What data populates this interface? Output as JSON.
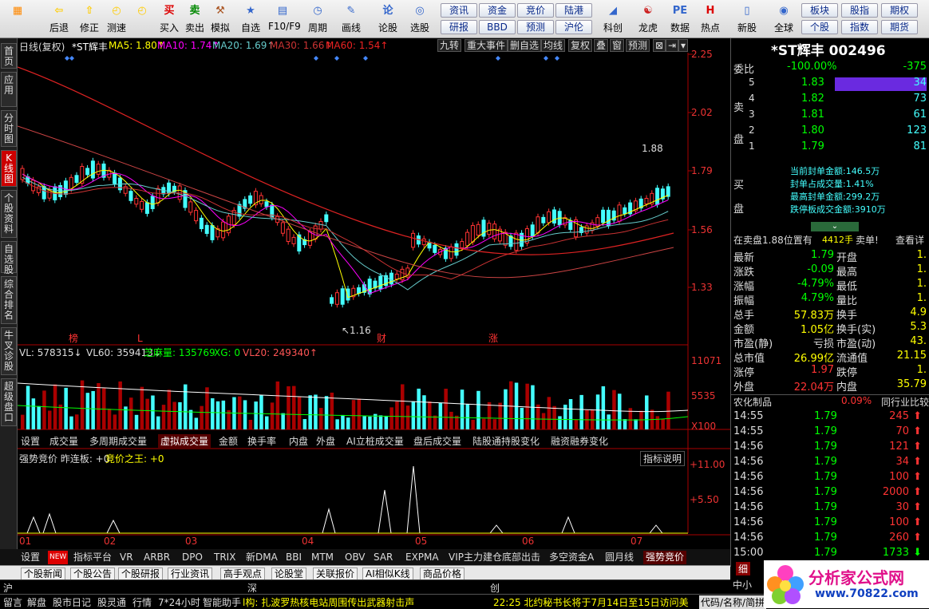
{
  "toolbar": {
    "buttons": [
      {
        "label": "",
        "icon": "grid-icon"
      },
      {
        "label": "后退",
        "icon": "arrow-left-icon"
      },
      {
        "label": "修正",
        "icon": "arrow-up-icon"
      },
      {
        "label": "测速",
        "icon": "clock-icon"
      },
      {
        "label": "",
        "icon": "clock-icon"
      },
      {
        "label": "买入",
        "icon": "buy-icon"
      },
      {
        "label": "卖出",
        "icon": "sell-icon"
      },
      {
        "label": "模拟",
        "icon": "hammer-icon"
      },
      {
        "label": "自选",
        "icon": "star-icon"
      },
      {
        "label": "F10/F9",
        "icon": "f10-icon"
      },
      {
        "label": "周期",
        "icon": "period-icon"
      },
      {
        "label": "画线",
        "icon": "pencil-icon"
      },
      {
        "label": "论股",
        "icon": "discuss-icon"
      },
      {
        "label": "选股",
        "icon": "pick-icon"
      },
      {
        "label": "科创",
        "icon": "kc-icon"
      },
      {
        "label": "龙虎",
        "icon": "dragon-icon"
      },
      {
        "label": "数据",
        "icon": "pe-icon"
      },
      {
        "label": "热点",
        "icon": "hot-icon"
      },
      {
        "label": "新股",
        "icon": "new-icon"
      },
      {
        "label": "全球",
        "icon": "globe-icon"
      }
    ],
    "grid_left": [
      "资讯",
      "资金",
      "竞价",
      "陆港",
      "研报",
      "BBD",
      "预测",
      "沪伦"
    ],
    "grid_right": [
      "板块",
      "股指",
      "期权",
      "个股",
      "指数",
      "期货"
    ]
  },
  "sidebar": [
    "首页",
    "应用",
    "分时图",
    "K线图",
    "个股资料",
    "自选股",
    "综合排名",
    "牛叉诊股",
    "超级盘口"
  ],
  "chart": {
    "header_left": "日线(复权)",
    "stock_name": "*ST辉丰",
    "ma5_label": "MA5: 1.80↑",
    "ma10_label": "MA10: 1.74↑",
    "ma20_label": "MA20: 1.69↑",
    "ma30_label": "MA30: 1.66↑",
    "ma60_label": "MA60: 1.54↑",
    "menu_tabs": [
      "九转",
      "重大事件",
      "删自选",
      "均线",
      "复权",
      "叠",
      "窗",
      "预测"
    ],
    "price_ticks": [
      "2.25",
      "2.02",
      "1.79",
      "1.56",
      "1.33"
    ],
    "high_label": "1.88",
    "low_label": "1.16",
    "markers": [
      "榜",
      "L",
      "财",
      "涨"
    ],
    "vol_header": {
      "vl": "VL: 578315",
      "vl60": "VL60: 359413",
      "zm": "芝麻量: 135769",
      "xg": "XG: 0",
      "vl20": "VL20: 249340"
    },
    "vol_ticks": [
      "11071",
      "5535",
      "X100"
    ],
    "vol_tabs": [
      "设置",
      "成交量",
      "多周期成交量",
      "虚拟成交量",
      "金额",
      "换手率",
      "内盘",
      "外盘",
      "AI立桩成交量",
      "盘后成交量",
      "陆股通持股变化",
      "融资融券变化"
    ],
    "ind_header": "强势竞价 昨连板: +0",
    "ind_header2": "竞价之王: +0",
    "ind_button": "指标说明",
    "ind_ticks": [
      "+11.00",
      "+5.50"
    ],
    "months": [
      "01",
      "02",
      "03",
      "04",
      "05",
      "06",
      "07"
    ]
  },
  "bottom_tabs": [
    "设置",
    "NEW",
    "指标平台",
    "VR",
    "ARBR",
    "DPO",
    "TRIX",
    "新DMA",
    "BBI",
    "MTM",
    "OBV",
    "SAR",
    "EXPMA",
    "VIP主力建仓底部出击",
    "多空资金A",
    "圆月线",
    "强势竞价"
  ],
  "news_tabs": [
    "个股新闻",
    "个股公告",
    "个股研报",
    "行业资讯",
    "高手观点",
    "论股堂",
    "关联报价",
    "AI相似K线",
    "商品价格"
  ],
  "market": {
    "sh": "沪",
    "sz": "深",
    "cy": "创"
  },
  "status": {
    "items": [
      "留言",
      "解盘",
      "股市日记",
      "股灵通",
      "行情",
      "7*24小时",
      "智能助手"
    ],
    "ticker": "l构: 扎波罗热核电站周围传出武器射击声",
    "ticker2": "22:25 北约秘书长将于7月14日至15日访问美",
    "code": "代码/名称/简拼"
  },
  "quote": {
    "title": "*ST辉丰 002496",
    "wb_label": "委比",
    "wb": "-100.00%",
    "wc": "-375",
    "sell_label": "卖盘",
    "buy_label": "买盘",
    "sells": [
      {
        "n": "5",
        "p": "1.83",
        "v": "34"
      },
      {
        "n": "4",
        "p": "1.82",
        "v": "73"
      },
      {
        "n": "3",
        "p": "1.81",
        "v": "61"
      },
      {
        "n": "2",
        "p": "1.80",
        "v": "123"
      },
      {
        "n": "1",
        "p": "1.79",
        "v": "81"
      }
    ],
    "fengdan": [
      "当前封单金额:146.5万",
      "封单占成交量:1.41%",
      "最高封单金额:299.2万",
      "跌停板成交金额:3910万"
    ],
    "zaimai": "在卖盘1.88位置有",
    "zaimai_v": "4412手",
    "zaimai_t": "卖单!",
    "zaimai_b": "查看详",
    "stats": [
      {
        "k1": "最新",
        "v1": "1.79",
        "k2": "开盘",
        "v2": "1."
      },
      {
        "k1": "涨跌",
        "v1": "-0.09",
        "k2": "最高",
        "v2": "1."
      },
      {
        "k1": "涨幅",
        "v1": "-4.79%",
        "k2": "最低",
        "v2": "1."
      },
      {
        "k1": "振幅",
        "v1": "4.79%",
        "k2": "量比",
        "v2": "1."
      },
      {
        "k1": "总手",
        "v1": "57.83万",
        "k2": "换手",
        "v2": "4.9"
      },
      {
        "k1": "金额",
        "v1": "1.05亿",
        "k2": "换手(实)",
        "v2": "5.3"
      },
      {
        "k1": "市盈(静)",
        "v1": "亏损",
        "k2": "市盈(动)",
        "v2": "43."
      },
      {
        "k1": "总市值",
        "v1": "26.99亿",
        "k2": "流通值",
        "v2": "21.15"
      },
      {
        "k1": "涨停",
        "v1": "1.97",
        "k2": "跌停",
        "v2": "1."
      },
      {
        "k1": "外盘",
        "v1": "22.04万",
        "k2": "内盘",
        "v2": "35.79"
      }
    ],
    "industry": "农化制品",
    "industry_pct": "0.09%",
    "industry_btn": "同行业比较",
    "ticks": [
      {
        "t": "14:55",
        "p": "1.79",
        "v": "245"
      },
      {
        "t": "14:55",
        "p": "1.79",
        "v": "70"
      },
      {
        "t": "14:56",
        "p": "1.79",
        "v": "121"
      },
      {
        "t": "14:56",
        "p": "1.79",
        "v": "34"
      },
      {
        "t": "14:56",
        "p": "1.79",
        "v": "100"
      },
      {
        "t": "14:56",
        "p": "1.79",
        "v": "2000"
      },
      {
        "t": "14:56",
        "p": "1.79",
        "v": "30"
      },
      {
        "t": "14:56",
        "p": "1.79",
        "v": "100"
      },
      {
        "t": "14:56",
        "p": "1.79",
        "v": "260"
      },
      {
        "t": "15:00",
        "p": "1.79",
        "v": "1733"
      }
    ],
    "bottom_tab": "细",
    "bottom_tab2": "中小"
  },
  "brand": {
    "name": "分析家公式网",
    "url": "www.70822.com"
  }
}
